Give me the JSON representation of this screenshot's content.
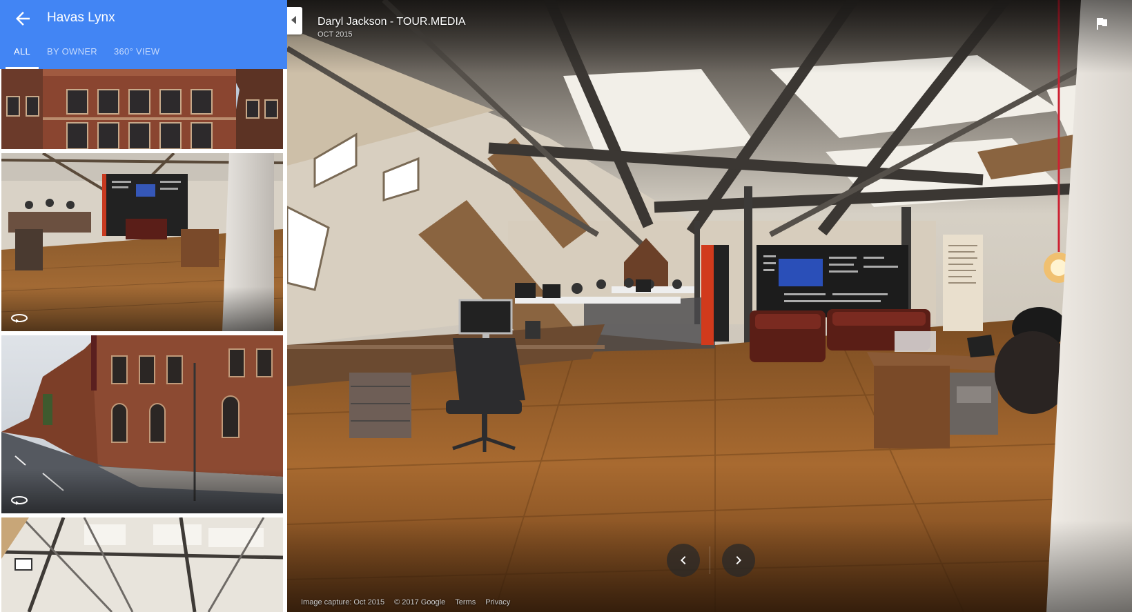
{
  "panel": {
    "title": "Havas Lynx",
    "tabs": [
      {
        "label": "ALL",
        "active": true
      },
      {
        "label": "BY OWNER",
        "active": false
      },
      {
        "label": "360° VIEW",
        "active": false
      }
    ],
    "thumbnails": [
      {
        "scene": "building-facade",
        "panorama": false,
        "selected": false
      },
      {
        "scene": "office-interior",
        "panorama": true,
        "selected": true
      },
      {
        "scene": "street-corner",
        "panorama": true,
        "selected": false
      },
      {
        "scene": "office-ceiling",
        "panorama": false,
        "selected": false
      }
    ],
    "accent_color": "#4285f4"
  },
  "viewer": {
    "author": "Daryl Jackson - TOUR.MEDIA",
    "date": "OCT 2015",
    "footer": {
      "capture": "Image capture: Oct 2015",
      "copyright": "© 2017 Google",
      "terms": "Terms",
      "privacy": "Privacy"
    },
    "icons": {
      "collapse": "chevron-left-icon",
      "report": "flag-icon",
      "prev": "chevron-left-icon",
      "next": "chevron-right-icon"
    }
  }
}
